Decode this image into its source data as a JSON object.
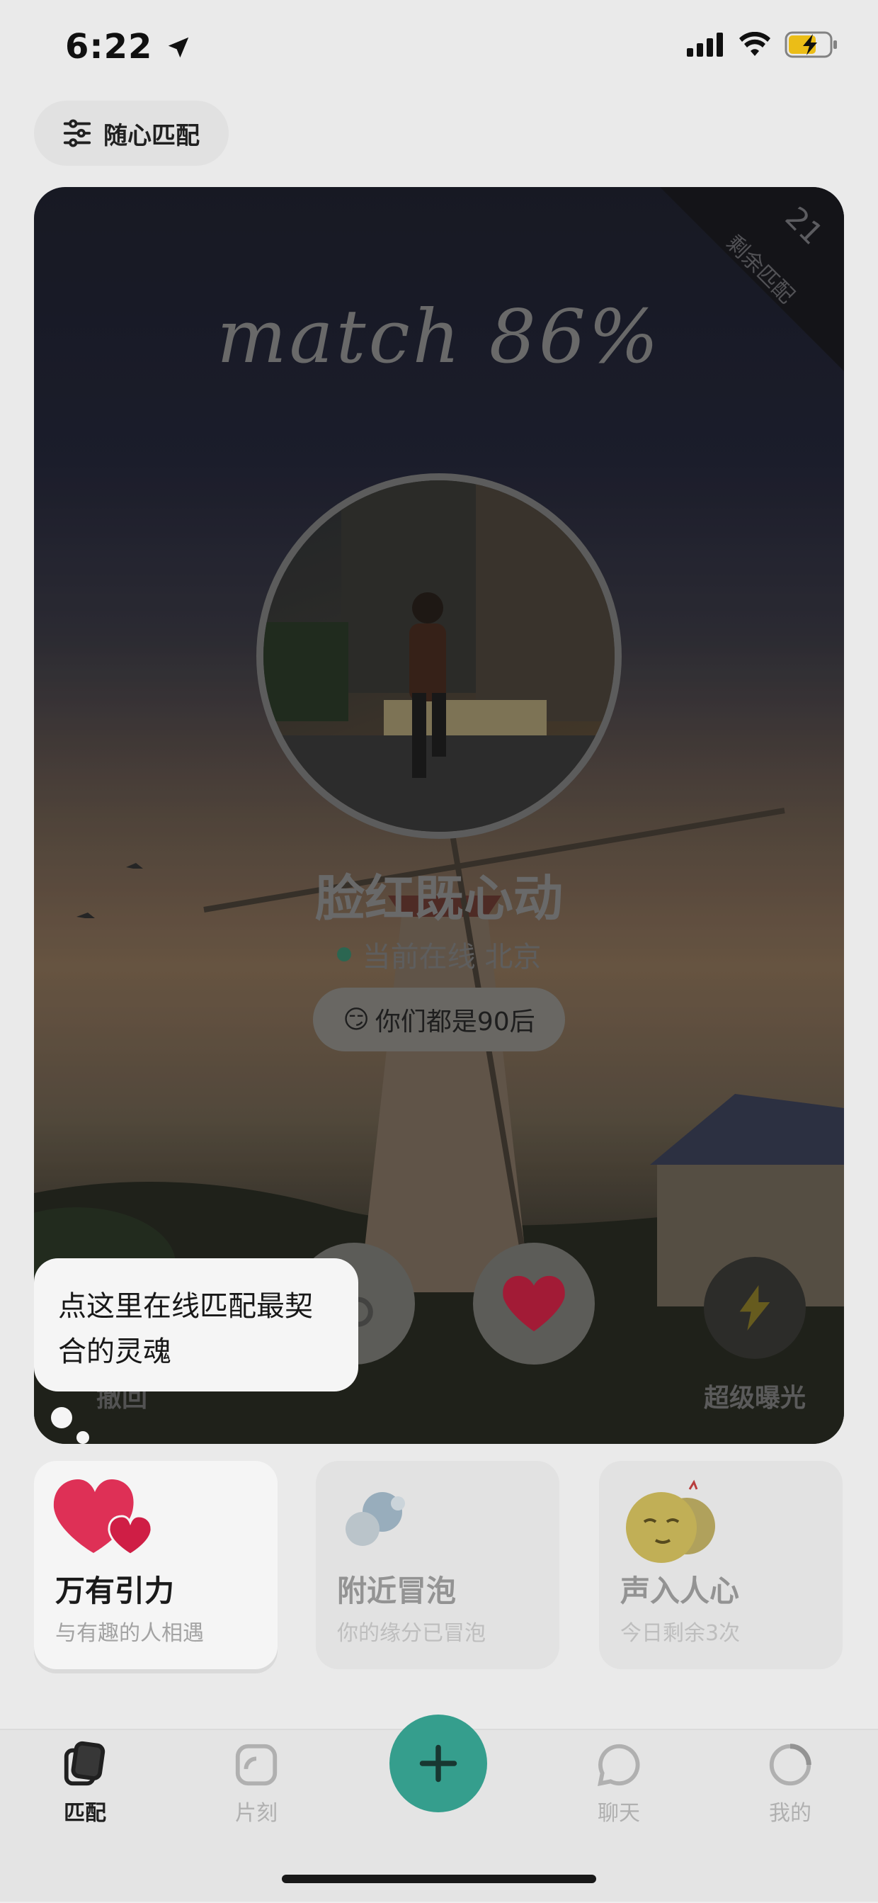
{
  "status_bar": {
    "time": "6:22"
  },
  "header": {
    "filter_label": "随心匹配",
    "filter_icon": "sliders-icon"
  },
  "card": {
    "remaining_count": "21",
    "remaining_label": "剩余匹配",
    "match_text": "match  86%",
    "name": "脸红既心动",
    "online_status": "当前在线 北京",
    "common_tag": "你们都是90后",
    "tag_emoji": "😏",
    "undo_label": "撤回",
    "super_label": "超级曝光"
  },
  "tooltip": {
    "text_line1": "点这里在线匹配最契",
    "text_line2": "合的灵魂"
  },
  "features": [
    {
      "title": "万有引力",
      "subtitle": "与有趣的人相遇",
      "icon": "hearts-icon"
    },
    {
      "title": "附近冒泡",
      "subtitle": "你的缘分已冒泡",
      "icon": "bubbles-icon"
    },
    {
      "title": "声入人心",
      "subtitle": "今日剩余3次",
      "icon": "emoji-faces-icon"
    }
  ],
  "tabbar": {
    "tabs": [
      {
        "label": "匹配",
        "icon": "cards-icon"
      },
      {
        "label": "片刻",
        "icon": "moment-icon"
      },
      {
        "label": "聊天",
        "icon": "chat-icon"
      },
      {
        "label": "我的",
        "icon": "profile-icon"
      }
    ],
    "plus_icon": "plus-icon"
  },
  "colors": {
    "accent": "#38a593",
    "heart": "#d9264a",
    "online": "#3a8a6e"
  }
}
